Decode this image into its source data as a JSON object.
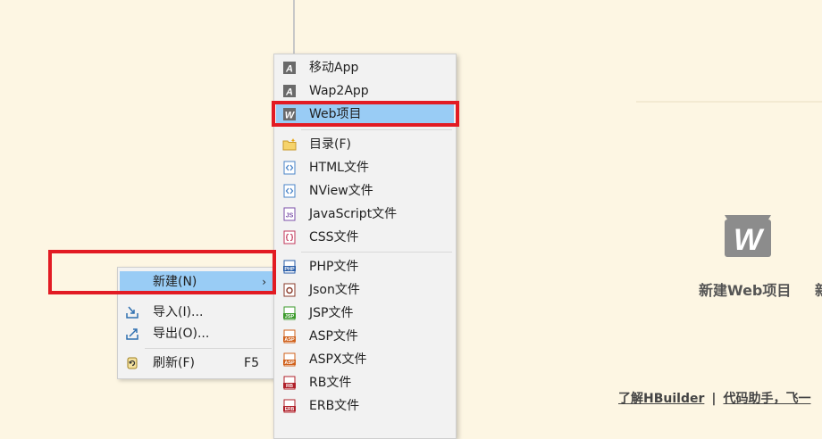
{
  "context_menu": {
    "items": [
      {
        "label": "新建(N)",
        "selected": true,
        "has_submenu": true,
        "icon": "none"
      },
      {
        "label": "导入(I)...",
        "icon": "import-icon"
      },
      {
        "label": "导出(O)...",
        "icon": "export-icon"
      },
      {
        "label": "刷新(F)",
        "shortcut": "F5",
        "icon": "refresh-icon"
      }
    ],
    "arrow": "›"
  },
  "submenu": {
    "items": [
      {
        "label": "移动App",
        "icon": "app-icon",
        "icon_letter": "A"
      },
      {
        "label": "Wap2App",
        "icon": "app-icon",
        "icon_letter": "A"
      },
      {
        "label": "Web项目",
        "icon": "web-project-icon",
        "icon_letter": "W",
        "selected": true
      },
      {
        "label": "目录(F)",
        "icon": "folder-icon"
      },
      {
        "label": "HTML文件",
        "icon": "html-file-icon"
      },
      {
        "label": "NView文件",
        "icon": "nview-file-icon"
      },
      {
        "label": "JavaScript文件",
        "icon": "js-file-icon",
        "icon_text": "JS"
      },
      {
        "label": "CSS文件",
        "icon": "css-file-icon"
      },
      {
        "label": "PHP文件",
        "icon": "php-file-icon",
        "icon_text": "PHP"
      },
      {
        "label": "Json文件",
        "icon": "json-file-icon"
      },
      {
        "label": "JSP文件",
        "icon": "jsp-file-icon",
        "icon_text": "JSP"
      },
      {
        "label": "ASP文件",
        "icon": "asp-file-icon",
        "icon_text": "ASP"
      },
      {
        "label": "ASPX文件",
        "icon": "aspx-file-icon",
        "icon_text": "ASP"
      },
      {
        "label": "RB文件",
        "icon": "rb-file-icon",
        "icon_text": "RB"
      },
      {
        "label": "ERB文件",
        "icon": "erb-file-icon",
        "icon_text": "ERB"
      }
    ]
  },
  "welcome": {
    "logo_letter": "W",
    "new_web_project": "新建Web项目",
    "next_action_partial": "新",
    "footer_link_1": "了解HBuilder",
    "footer_separator": "|",
    "footer_link_2": "代码助手，飞一"
  },
  "colors": {
    "background": "#fdf6e3",
    "menu_bg": "#f2f2f2",
    "selection": "#99ccf5",
    "highlight_box": "#e21b23",
    "logo_gray": "#8c8c8c"
  }
}
